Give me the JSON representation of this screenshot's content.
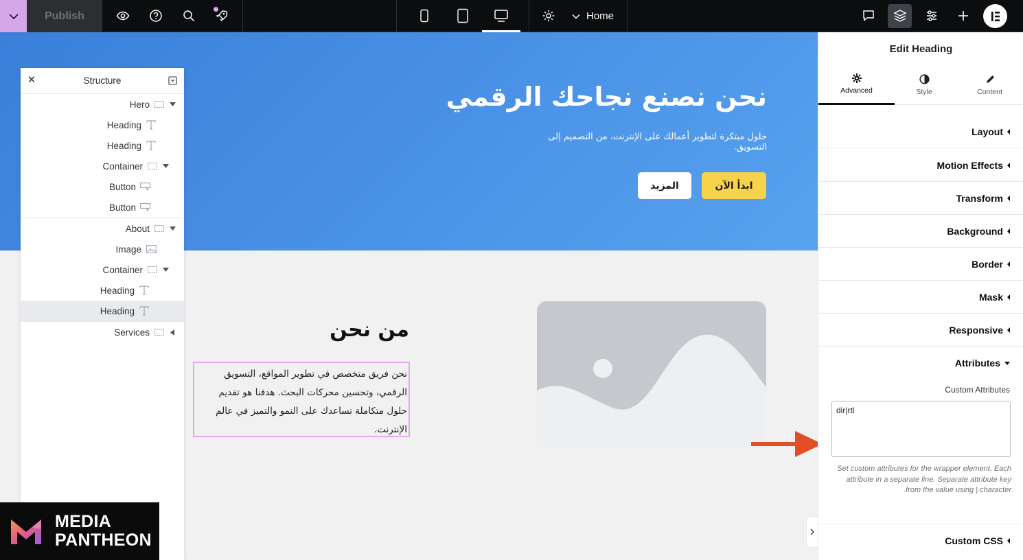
{
  "topbar": {
    "publish_label": "Publish",
    "home_label": "Home",
    "icons": [
      "menu-chevron-icon",
      "preview-eye-icon",
      "help-icon",
      "search-icon",
      "launchpad-icon",
      "mobile-icon",
      "tablet-icon",
      "desktop-icon",
      "settings-icon",
      "chevron-down-icon",
      "comments-icon",
      "layers-icon",
      "site-settings-icon",
      "add-icon",
      "elementor-logo"
    ]
  },
  "canvas": {
    "hero": {
      "heading": "نحن نصنع نجاحك الرقمي",
      "subtext": "حلول مبتكرة لتطوير أعمالك على الإنترنت، من التصميم إلى التسويق.",
      "btn_start": "ابدأ الآن",
      "btn_more": "المزيد",
      "bg_color": "#4a90e2",
      "btn_start_color": "#f7d24b"
    },
    "about": {
      "heading": "من نحن",
      "text": "نحن فريق متخصص في تطوير المواقع، التسويق الرقمي، وتحسين محركات البحث. هدفنا هو تقديم حلول متكاملة تساعدك على النمو والتميز في عالم الإنترنت."
    }
  },
  "structure": {
    "title": "Structure",
    "items": [
      {
        "label": "Hero",
        "type": "container"
      },
      {
        "label": "Heading",
        "type": "heading"
      },
      {
        "label": "Heading",
        "type": "heading"
      },
      {
        "label": "Container",
        "type": "container"
      },
      {
        "label": "Button",
        "type": "button"
      },
      {
        "label": "Button",
        "type": "button"
      },
      {
        "label": "About",
        "type": "container"
      },
      {
        "label": "Image",
        "type": "image"
      },
      {
        "label": "Container",
        "type": "container"
      },
      {
        "label": "Heading",
        "type": "heading"
      },
      {
        "label": "Heading",
        "type": "heading",
        "selected": true
      },
      {
        "label": "Services",
        "type": "container",
        "collapsed": true
      }
    ]
  },
  "brand": {
    "line1": "MEDIA",
    "line2": "PANTHEON"
  },
  "panel": {
    "title": "Edit Heading",
    "tabs": [
      {
        "label": "Advanced",
        "icon": "gear-icon",
        "active": true
      },
      {
        "label": "Style",
        "icon": "half-circle-icon",
        "active": false
      },
      {
        "label": "Content",
        "icon": "pencil-icon",
        "active": false
      }
    ],
    "sections": [
      "Layout",
      "Motion Effects",
      "Transform",
      "Background",
      "Border",
      "Mask",
      "Responsive",
      "Attributes",
      "Custom CSS"
    ],
    "custom_attributes_label": "Custom Attributes",
    "custom_attributes_value": "dir|rtl",
    "custom_attributes_help": "Set custom attributes for the wrapper element. Each attribute in a separate line. Separate attribute key from the value using | character.",
    "accent_color": "#e24f24"
  }
}
